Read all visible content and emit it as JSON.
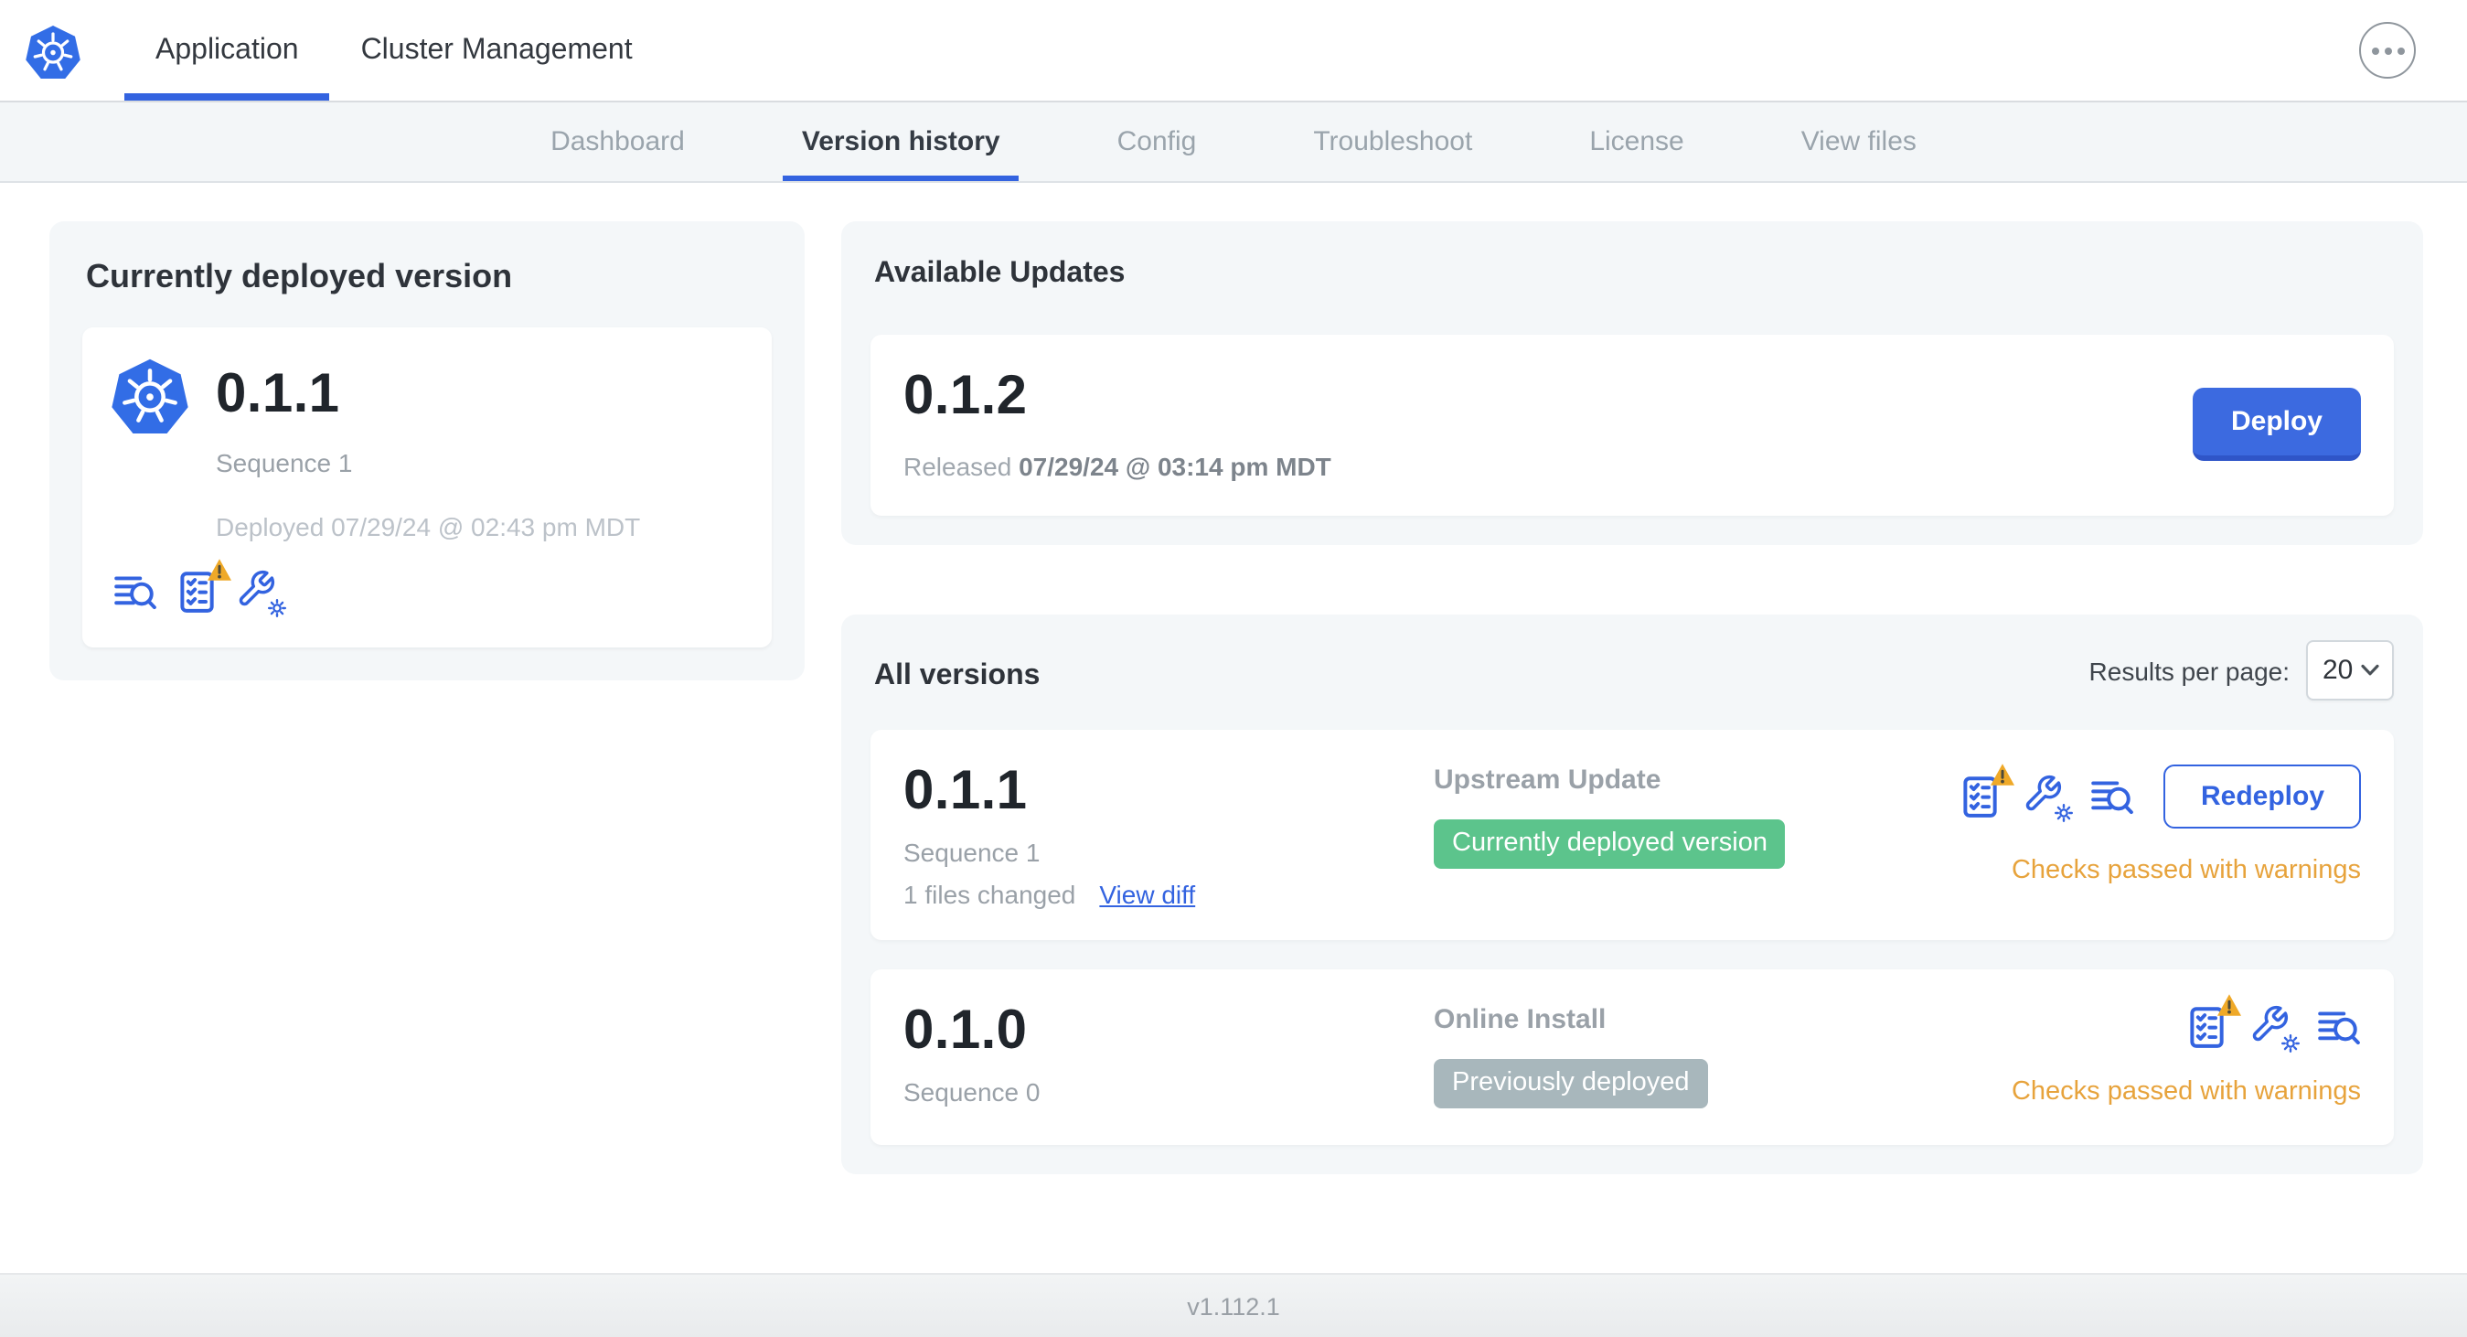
{
  "topbar": {
    "tabs": [
      {
        "label": "Application",
        "active": true
      },
      {
        "label": "Cluster Management",
        "active": false
      }
    ],
    "overflow_menu_icon": "ellipsis-icon",
    "logo_icon": "kubernetes-logo"
  },
  "subnav": {
    "tabs": [
      {
        "label": "Dashboard",
        "active": false
      },
      {
        "label": "Version history",
        "active": true
      },
      {
        "label": "Config",
        "active": false
      },
      {
        "label": "Troubleshoot",
        "active": false
      },
      {
        "label": "License",
        "active": false
      },
      {
        "label": "View files",
        "active": false
      }
    ]
  },
  "current": {
    "title": "Currently deployed version",
    "version": "0.1.1",
    "sequence": "Sequence 1",
    "deployed": "Deployed 07/29/24 @ 02:43 pm MDT",
    "icons": [
      "diff-log-icon",
      "preflight-checklist-warning-icon",
      "config-wrench-icon"
    ]
  },
  "updates": {
    "title": "Available Updates",
    "version": "0.1.2",
    "released_prefix": "Released",
    "released_date": "07/29/24 @ 03:14 pm MDT",
    "deploy_label": "Deploy"
  },
  "all_versions": {
    "title": "All versions",
    "results_per_page_label": "Results per page:",
    "results_per_page_value": "20",
    "rows": [
      {
        "version": "0.1.1",
        "sequence": "Sequence 1",
        "files_changed": "1 files changed",
        "view_diff_label": "View diff",
        "source": "Upstream Update",
        "badge": "Currently deployed version",
        "badge_style": "green",
        "icons": [
          "preflight-checklist-warning-icon",
          "config-wrench-icon",
          "diff-log-icon"
        ],
        "action_label": "Redeploy",
        "status": "Checks passed with warnings"
      },
      {
        "version": "0.1.0",
        "sequence": "Sequence 0",
        "source": "Online Install",
        "badge": "Previously deployed",
        "badge_style": "gray",
        "icons": [
          "preflight-checklist-warning-icon",
          "config-wrench-icon",
          "diff-log-icon"
        ],
        "status": "Checks passed with warnings"
      }
    ]
  },
  "footer": {
    "version": "v1.112.1"
  },
  "colors": {
    "accent_blue": "#3363e0",
    "deploy_blue": "#3c6ae0",
    "deploy_blue_dark": "#2f55c8",
    "k8s_blue": "#326de6",
    "badge_green": "#5cc48c",
    "badge_gray": "#a8b7bc",
    "warning_amber": "#e7a33c",
    "warning_triangle": "#efa928",
    "text_dark": "#32373e",
    "text_gray": "#9aa1a8",
    "text_light": "#bcc2c9",
    "card_bg": "#f4f7f9"
  }
}
